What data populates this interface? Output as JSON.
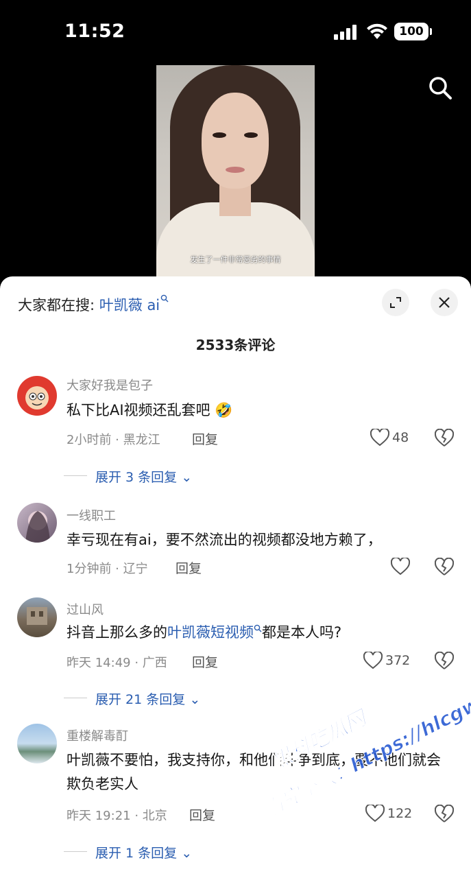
{
  "status_bar": {
    "time": "11:52",
    "battery": "100"
  },
  "video": {
    "caption": "发生了一件非常恶劣的事情"
  },
  "sheet": {
    "hot_search_prefix": "大家都在搜: ",
    "hot_search_keyword": "叶凯薇 ai",
    "comment_count": "2533条评论"
  },
  "comments": [
    {
      "user": "大家好我是包子",
      "text": "私下比AI视频还乱套吧",
      "emoji": "🤣",
      "time_location": "2小时前 · 黑龙江",
      "reply_label": "回复",
      "likes": "48",
      "expand": "展开 3 条回复"
    },
    {
      "user": "一线职工",
      "text": "幸亏现在有ai，要不然流出的视频都没地方赖了，",
      "time_location": "1分钟前 · 辽宁",
      "reply_label": "回复",
      "likes": ""
    },
    {
      "user": "过山风",
      "text_before": "抖音上那么多的",
      "text_keyword": "叶凯薇短视频",
      "text_after": "都是本人吗?",
      "time_location": "昨天 14:49 · 广西",
      "reply_label": "回复",
      "likes": "372",
      "expand": "展开 21 条回复"
    },
    {
      "user": "重楼解毒酊",
      "text": "叶凯薇不要怕，我支持你，和他们斗争到底，要不他们就会欺负老实人",
      "time_location": "昨天 19:21 · 北京",
      "reply_label": "回复",
      "likes": "122",
      "expand": "展开 1 条回复"
    }
  ],
  "watermark": {
    "line1": "黑料吃瓜网",
    "line2": "看完整版：https://hlcgw.co"
  },
  "colors": {
    "link": "#2a5db0",
    "muted": "#8a8a8a",
    "sheet_bg": "#ffffff",
    "page_bg": "#000000"
  }
}
